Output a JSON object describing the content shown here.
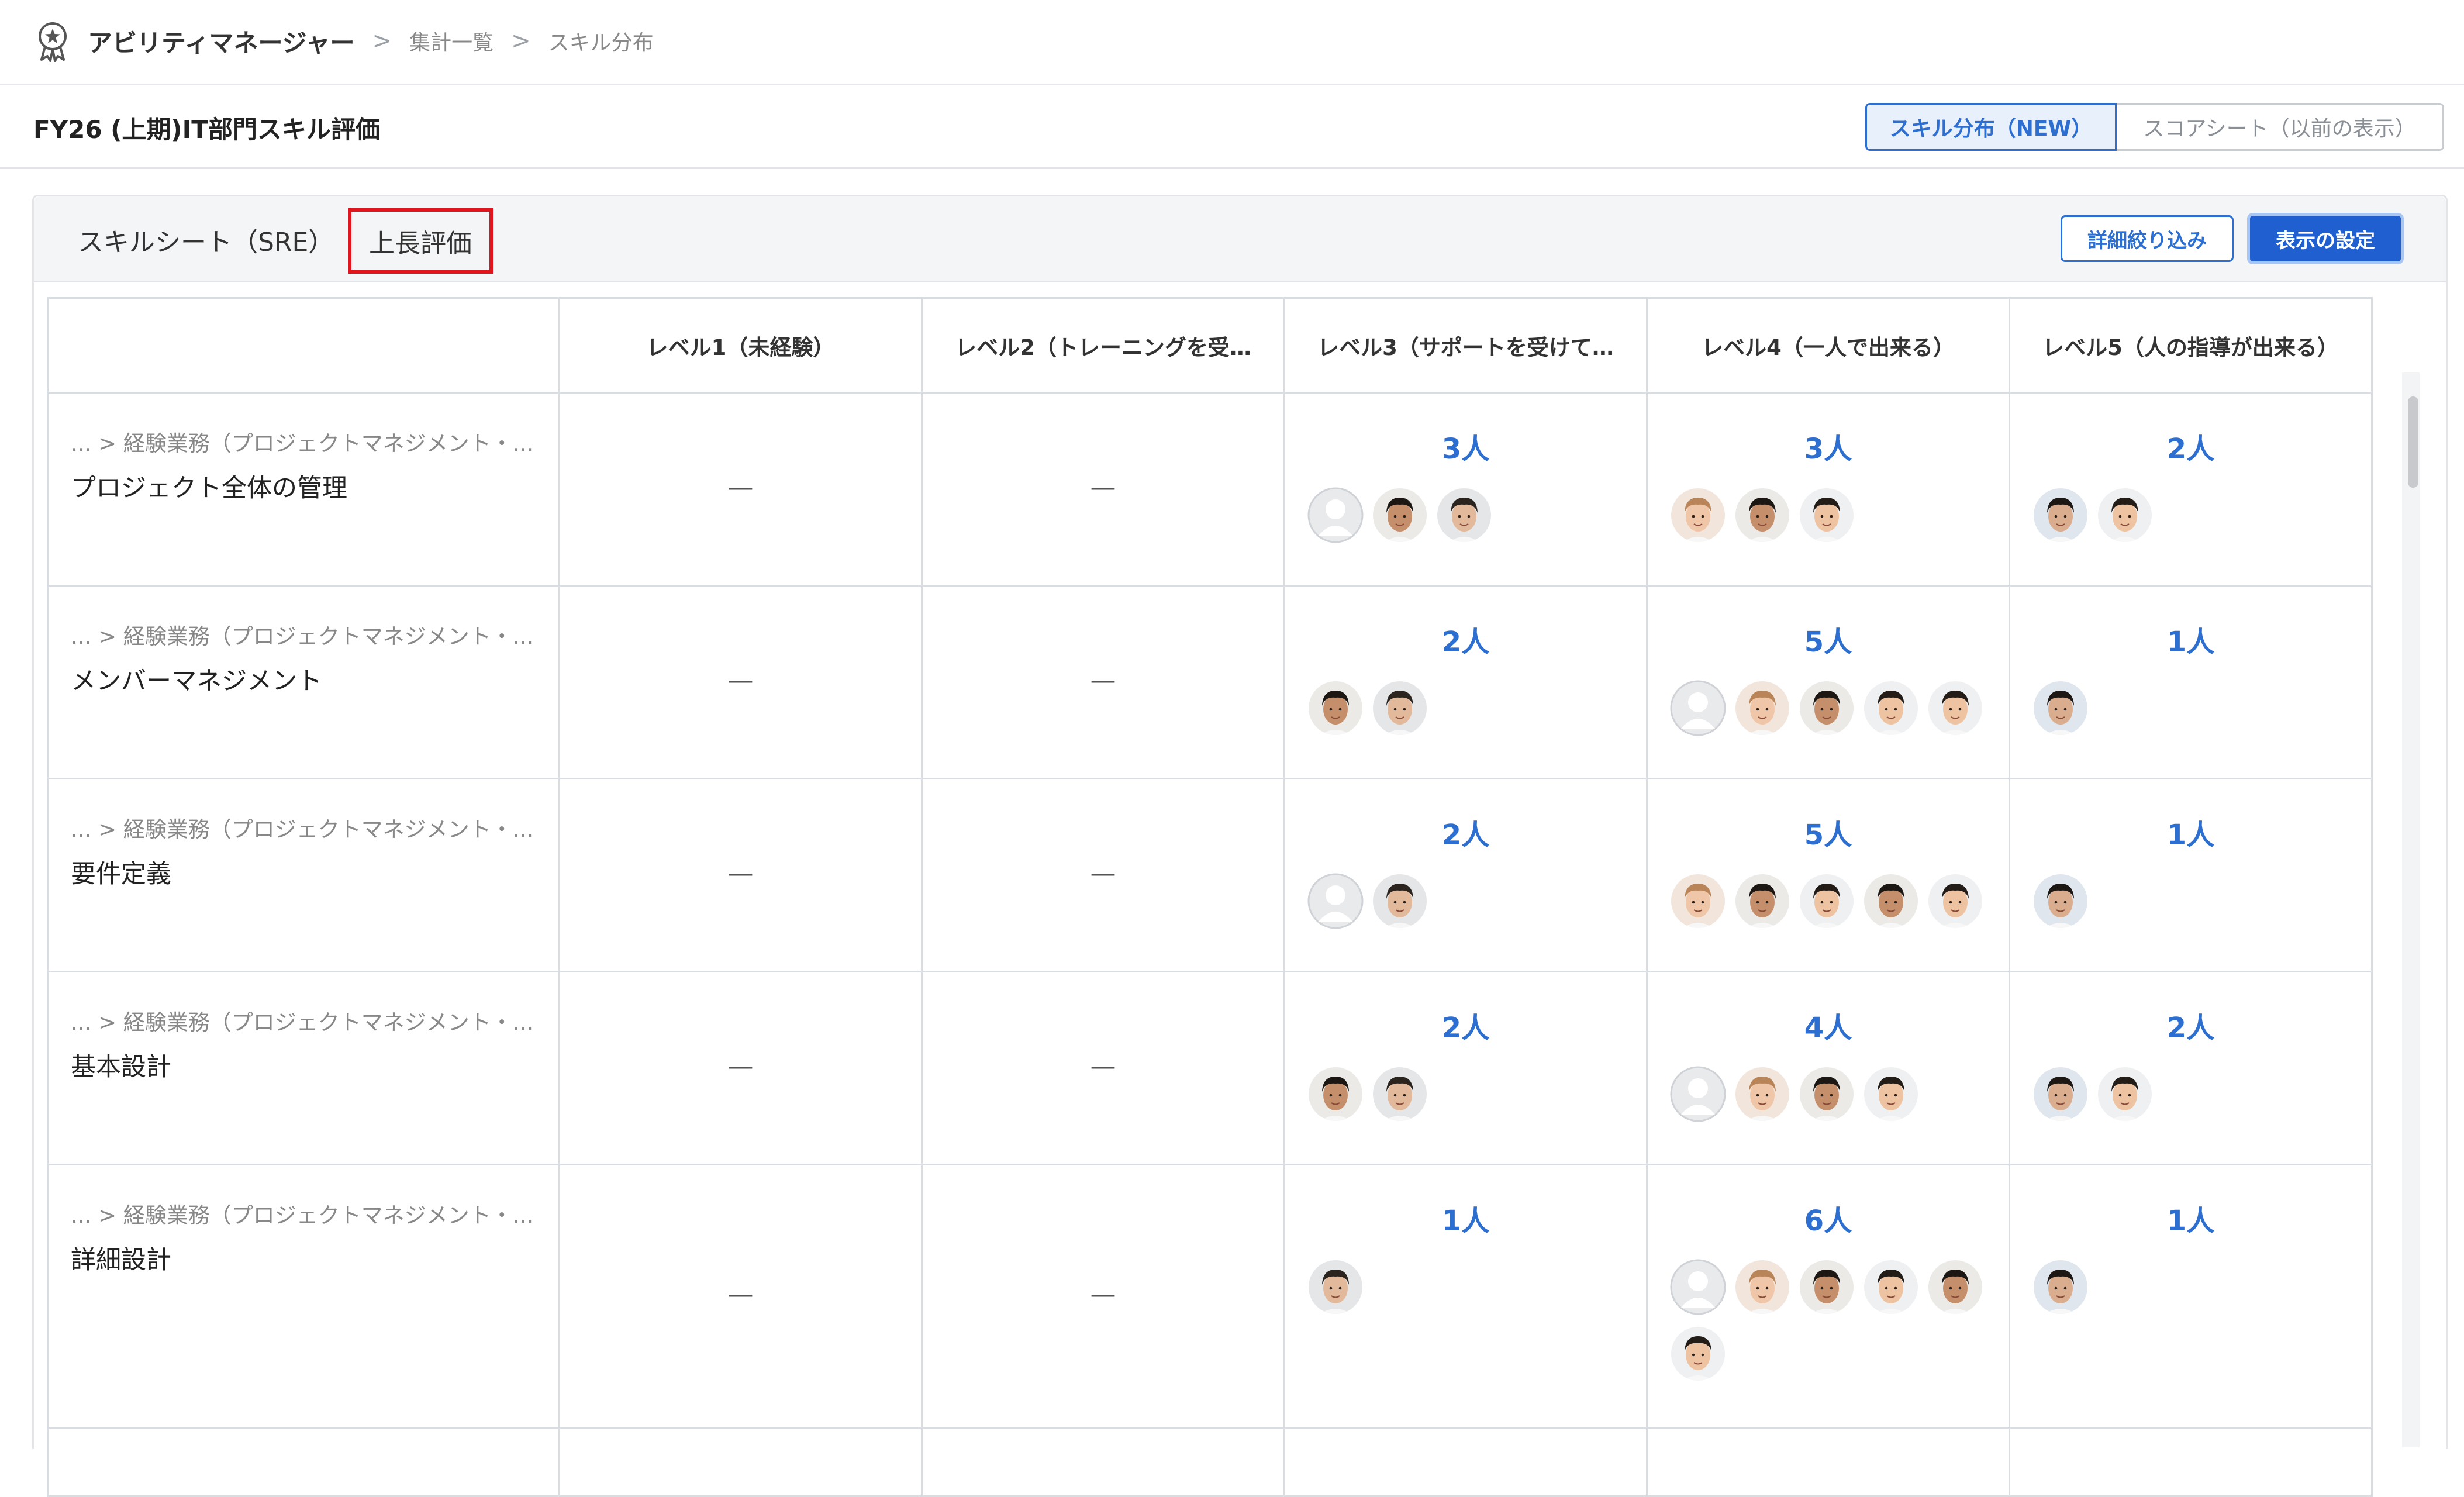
{
  "header": {
    "app_name": "アビリティマネージャー",
    "breadcrumb": [
      "集計一覧",
      "スキル分布"
    ],
    "separator": ">"
  },
  "page": {
    "title": "FY26 (上期)IT部門スキル評価",
    "view_toggle": [
      "スキル分布（NEW）",
      "スコアシート（以前の表示）"
    ],
    "active_view": "スキル分布（NEW）"
  },
  "panel": {
    "tabs": [
      "スキルシート（SRE）",
      "上長評価"
    ],
    "highlighted_tab": "上長評価",
    "filter_button": "詳細絞り込み",
    "display_settings_button": "表示の設定"
  },
  "table": {
    "columns": [
      "",
      "レベル1（未経験）",
      "レベル2（トレーニングを受…",
      "レベル3（サポートを受けて…",
      "レベル4（一人で出来る）",
      "レベル5（人の指導が出来る）"
    ],
    "empty_mark": "—",
    "rows": [
      {
        "path": "... > 経験業務（プロジェクトマネジメント・...",
        "name": "プロジェクト全体の管理",
        "levels": [
          {
            "count": null,
            "avatars": []
          },
          {
            "count": null,
            "avatars": []
          },
          {
            "count": "3人",
            "avatars": [
              "placeholder",
              "m-short",
              "m-long"
            ]
          },
          {
            "count": "3人",
            "avatars": [
              "f-1",
              "m-short",
              "m-fair"
            ]
          },
          {
            "count": "2人",
            "avatars": [
              "m-tilt",
              "m-fair"
            ]
          }
        ]
      },
      {
        "path": "... > 経験業務（プロジェクトマネジメント・...",
        "name": "メンバーマネジメント",
        "levels": [
          {
            "count": null,
            "avatars": []
          },
          {
            "count": null,
            "avatars": []
          },
          {
            "count": "2人",
            "avatars": [
              "m-short",
              "m-long"
            ]
          },
          {
            "count": "5人",
            "avatars": [
              "placeholder",
              "f-1",
              "m-short",
              "m-fair",
              "m-fair"
            ]
          },
          {
            "count": "1人",
            "avatars": [
              "m-tilt"
            ]
          }
        ]
      },
      {
        "path": "... > 経験業務（プロジェクトマネジメント・...",
        "name": "要件定義",
        "levels": [
          {
            "count": null,
            "avatars": []
          },
          {
            "count": null,
            "avatars": []
          },
          {
            "count": "2人",
            "avatars": [
              "placeholder",
              "m-long"
            ]
          },
          {
            "count": "5人",
            "avatars": [
              "f-1",
              "m-short",
              "m-fair",
              "m-short",
              "m-fair"
            ]
          },
          {
            "count": "1人",
            "avatars": [
              "m-tilt"
            ]
          }
        ]
      },
      {
        "path": "... > 経験業務（プロジェクトマネジメント・...",
        "name": "基本設計",
        "levels": [
          {
            "count": null,
            "avatars": []
          },
          {
            "count": null,
            "avatars": []
          },
          {
            "count": "2人",
            "avatars": [
              "m-short",
              "m-long"
            ]
          },
          {
            "count": "4人",
            "avatars": [
              "placeholder",
              "f-1",
              "m-short",
              "m-fair"
            ]
          },
          {
            "count": "2人",
            "avatars": [
              "m-tilt",
              "m-fair"
            ]
          }
        ]
      },
      {
        "path": "... > 経験業務（プロジェクトマネジメント・...",
        "name": "詳細設計",
        "levels": [
          {
            "count": null,
            "avatars": []
          },
          {
            "count": null,
            "avatars": []
          },
          {
            "count": "1人",
            "avatars": [
              "m-long"
            ]
          },
          {
            "count": "6人",
            "avatars": [
              "placeholder",
              "f-1",
              "m-short",
              "m-fair",
              "m-short",
              "m-fair"
            ]
          },
          {
            "count": "1人",
            "avatars": [
              "m-tilt"
            ]
          }
        ]
      }
    ]
  },
  "colors": {
    "accent": "#2d6fd1",
    "highlight_border": "#e3141c",
    "grid_line": "#d9dce1"
  }
}
